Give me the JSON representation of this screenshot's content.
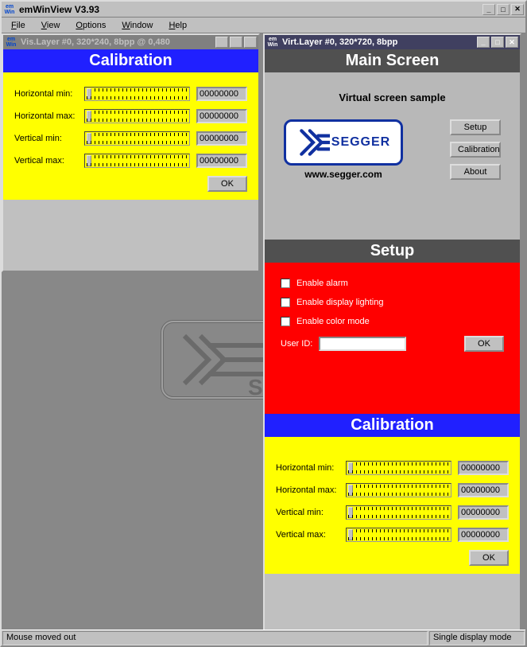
{
  "app": {
    "title": "emWinView V3.93",
    "icon_top": "em",
    "icon_bot": "Win"
  },
  "menu": [
    "File",
    "View",
    "Options",
    "Window",
    "Help"
  ],
  "status": {
    "left": "Mouse moved out",
    "right": "Single display mode"
  },
  "window_left": {
    "title": "Vis.Layer #0, 320*240, 8bpp @ 0,480"
  },
  "window_right": {
    "title": "Virt.Layer #0, 320*720, 8bpp"
  },
  "calibration": {
    "header": "Calibration",
    "rows": [
      {
        "label": "Horizontal min:",
        "value": "00000000",
        "thumb": 2
      },
      {
        "label": "Horizontal max:",
        "value": "00000000",
        "thumb": 2
      },
      {
        "label": "Vertical  min:",
        "value": "00000000",
        "thumb": 2
      },
      {
        "label": "Vertical  max:",
        "value": "00000000",
        "thumb": 2
      }
    ],
    "ok": "OK"
  },
  "main_screen": {
    "header": "Main Screen",
    "sample": "Virtual screen sample",
    "logo_text": "SEGGER",
    "url": "www.segger.com",
    "buttons": [
      "Setup",
      "Calibration",
      "About"
    ]
  },
  "setup": {
    "header": "Setup",
    "checks": [
      "Enable alarm",
      "Enable display lighting",
      "Enable color mode"
    ],
    "user_id_label": "User ID:",
    "ok": "OK"
  },
  "win_btns": {
    "min": "_",
    "max": "□",
    "close": "✕"
  }
}
